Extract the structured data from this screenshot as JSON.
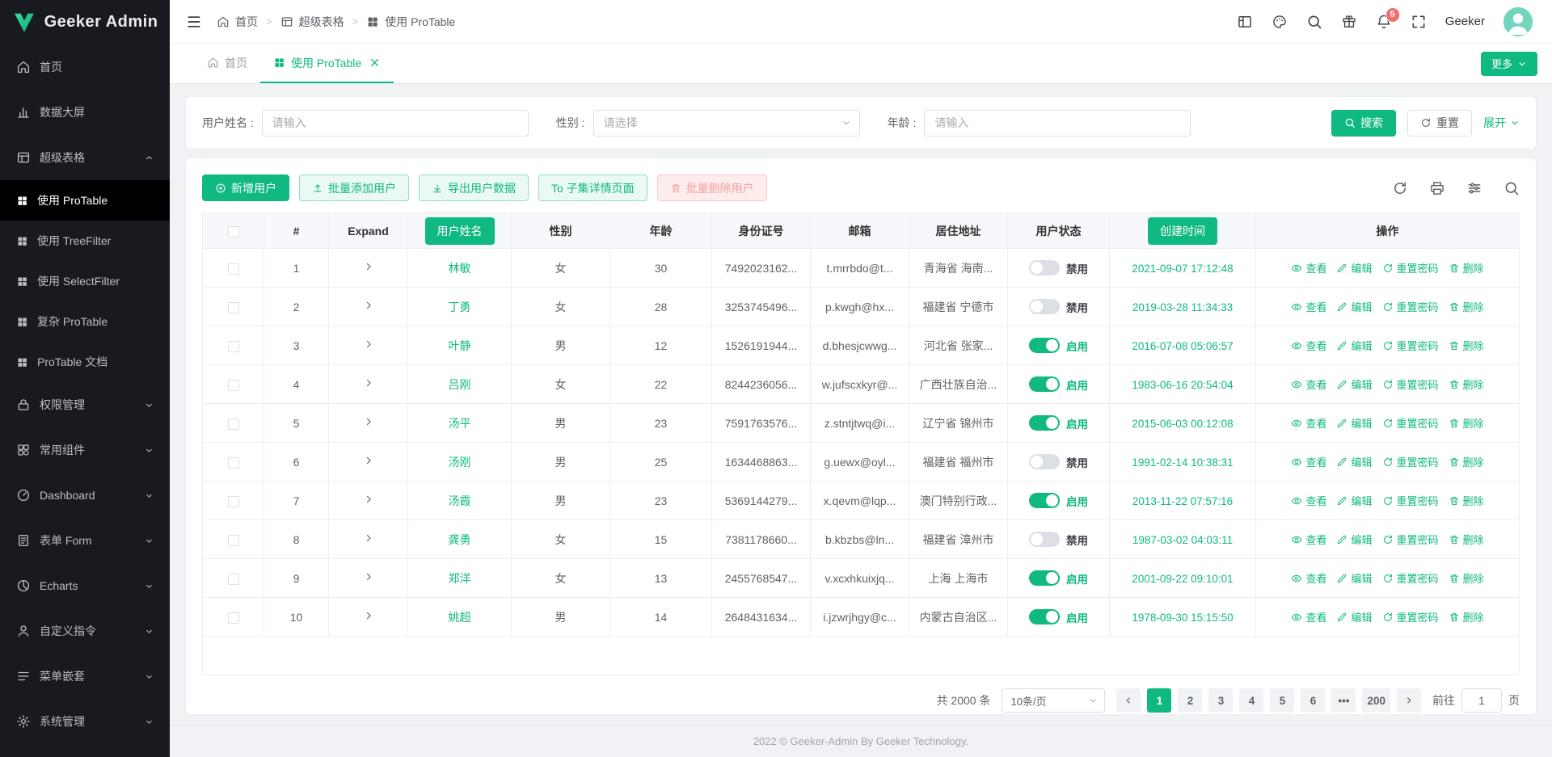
{
  "colors": {
    "primary": "#10b981",
    "danger": "#f56c6c",
    "sidebar_bg": "#191a20"
  },
  "app": {
    "logo_text": "Geeker Admin",
    "footer_text": "2022 © Geeker-Admin By Geeker Technology."
  },
  "header": {
    "breadcrumb": [
      {
        "label": "首页",
        "icon": "home"
      },
      {
        "label": "超级表格",
        "icon": "table"
      },
      {
        "label": "使用 ProTable",
        "icon": "grid"
      }
    ],
    "notification_count": "5",
    "username": "Geeker"
  },
  "sidebar": {
    "items": [
      {
        "label": "首页",
        "icon": "home"
      },
      {
        "label": "数据大屏",
        "icon": "chart"
      },
      {
        "label": "超级表格",
        "icon": "table",
        "expanded": true,
        "children": [
          {
            "label": "使用 ProTable",
            "active": true
          },
          {
            "label": "使用 TreeFilter",
            "active": false
          },
          {
            "label": "使用 SelectFilter",
            "active": false
          },
          {
            "label": "复杂 ProTable",
            "active": false
          },
          {
            "label": "ProTable 文档",
            "active": false
          }
        ]
      },
      {
        "label": "权限管理",
        "icon": "lock",
        "collapsible": true
      },
      {
        "label": "常用组件",
        "icon": "component",
        "collapsible": true
      },
      {
        "label": "Dashboard",
        "icon": "dashboard",
        "collapsible": true
      },
      {
        "label": "表单 Form",
        "icon": "form",
        "collapsible": true
      },
      {
        "label": "Echarts",
        "icon": "echarts",
        "collapsible": true
      },
      {
        "label": "自定义指令",
        "icon": "user",
        "collapsible": true
      },
      {
        "label": "菜单嵌套",
        "icon": "menu",
        "collapsible": true
      },
      {
        "label": "系统管理",
        "icon": "gear",
        "collapsible": true
      }
    ]
  },
  "tabs": {
    "items": [
      {
        "label": "首页",
        "icon": "home",
        "active": false,
        "closable": false
      },
      {
        "label": "使用 ProTable",
        "icon": "grid",
        "active": true,
        "closable": true
      }
    ],
    "more_label": "更多"
  },
  "search": {
    "fields": [
      {
        "key": "username",
        "label": "用户姓名 :",
        "placeholder": "请输入",
        "type": "input"
      },
      {
        "key": "gender",
        "label": "性别 :",
        "placeholder": "请选择",
        "type": "select"
      },
      {
        "key": "age",
        "label": "年龄 :",
        "placeholder": "请输入",
        "type": "input"
      }
    ],
    "search_label": "搜索",
    "reset_label": "重置",
    "expand_label": "展开"
  },
  "toolbar": {
    "buttons": [
      {
        "key": "add-user",
        "label": "新增用户",
        "style": "primary",
        "icon": "plus"
      },
      {
        "key": "batch-add-user",
        "label": "批量添加用户",
        "style": "plain",
        "icon": "upload"
      },
      {
        "key": "export-user-data",
        "label": "导出用户数据",
        "style": "plain",
        "icon": "download"
      },
      {
        "key": "to-child-detail",
        "label": "To 子集详情页面",
        "style": "plain",
        "icon": ""
      },
      {
        "key": "batch-delete-user",
        "label": "批量删除用户",
        "style": "danger",
        "icon": "trash"
      }
    ]
  },
  "table": {
    "headers": [
      {
        "label": "#"
      },
      {
        "label": "Expand"
      },
      {
        "label": "用户姓名",
        "button": true
      },
      {
        "label": "性别"
      },
      {
        "label": "年龄"
      },
      {
        "label": "身份证号"
      },
      {
        "label": "邮箱"
      },
      {
        "label": "居住地址"
      },
      {
        "label": "用户状态"
      },
      {
        "label": "创建时间",
        "button": true
      },
      {
        "label": "操作"
      }
    ],
    "status_on": "启用",
    "status_off": "禁用",
    "actions": [
      {
        "key": "view",
        "label": "查看",
        "icon": "eye"
      },
      {
        "key": "edit",
        "label": "编辑",
        "icon": "pen"
      },
      {
        "key": "reset-password",
        "label": "重置密码",
        "icon": "refresh"
      },
      {
        "key": "delete",
        "label": "删除",
        "icon": "trash"
      }
    ],
    "rows": [
      {
        "index": "1",
        "name": "林敏",
        "gender": "女",
        "age": "30",
        "idcard": "7492023162...",
        "email": "t.mrrbdo@t...",
        "address": "青海省 海南...",
        "status": false,
        "created": "2021-09-07 17:12:48"
      },
      {
        "index": "2",
        "name": "丁勇",
        "gender": "女",
        "age": "28",
        "idcard": "3253745496...",
        "email": "p.kwgh@hx...",
        "address": "福建省 宁德市",
        "status": false,
        "created": "2019-03-28 11:34:33"
      },
      {
        "index": "3",
        "name": "叶静",
        "gender": "男",
        "age": "12",
        "idcard": "1526191944...",
        "email": "d.bhesjcwwg...",
        "address": "河北省 张家...",
        "status": true,
        "created": "2016-07-08 05:06:57"
      },
      {
        "index": "4",
        "name": "吕刚",
        "gender": "女",
        "age": "22",
        "idcard": "8244236056...",
        "email": "w.jufscxkyr@...",
        "address": "广西壮族自治...",
        "status": true,
        "created": "1983-06-16 20:54:04"
      },
      {
        "index": "5",
        "name": "汤平",
        "gender": "男",
        "age": "23",
        "idcard": "7591763576...",
        "email": "z.stntjtwq@i...",
        "address": "辽宁省 锦州市",
        "status": true,
        "created": "2015-06-03 00:12:08"
      },
      {
        "index": "6",
        "name": "汤刚",
        "gender": "男",
        "age": "25",
        "idcard": "1634468863...",
        "email": "g.uewx@oyl...",
        "address": "福建省 福州市",
        "status": false,
        "created": "1991-02-14 10:38:31"
      },
      {
        "index": "7",
        "name": "汤霞",
        "gender": "男",
        "age": "23",
        "idcard": "5369144279...",
        "email": "x.qevm@lqp...",
        "address": "澳门特别行政...",
        "status": true,
        "created": "2013-11-22 07:57:16"
      },
      {
        "index": "8",
        "name": "龚勇",
        "gender": "女",
        "age": "15",
        "idcard": "7381178660...",
        "email": "b.kbzbs@ln...",
        "address": "福建省 漳州市",
        "status": false,
        "created": "1987-03-02 04:03:11"
      },
      {
        "index": "9",
        "name": "郑洋",
        "gender": "女",
        "age": "13",
        "idcard": "2455768547...",
        "email": "v.xcxhkuixjq...",
        "address": "上海 上海市",
        "status": true,
        "created": "2001-09-22 09:10:01"
      },
      {
        "index": "10",
        "name": "姚超",
        "gender": "男",
        "age": "14",
        "idcard": "2648431634...",
        "email": "i.jzwrjhgy@c...",
        "address": "内蒙古自治区...",
        "status": true,
        "created": "1978-09-30 15:15:50"
      }
    ]
  },
  "pagination": {
    "total": "共 2000 条",
    "page_size": "10条/页",
    "pages": [
      "1",
      "2",
      "3",
      "4",
      "5",
      "6",
      "...",
      "200"
    ],
    "active": "1",
    "goto_label": "前往",
    "goto_value": "1",
    "unit_label": "页"
  }
}
